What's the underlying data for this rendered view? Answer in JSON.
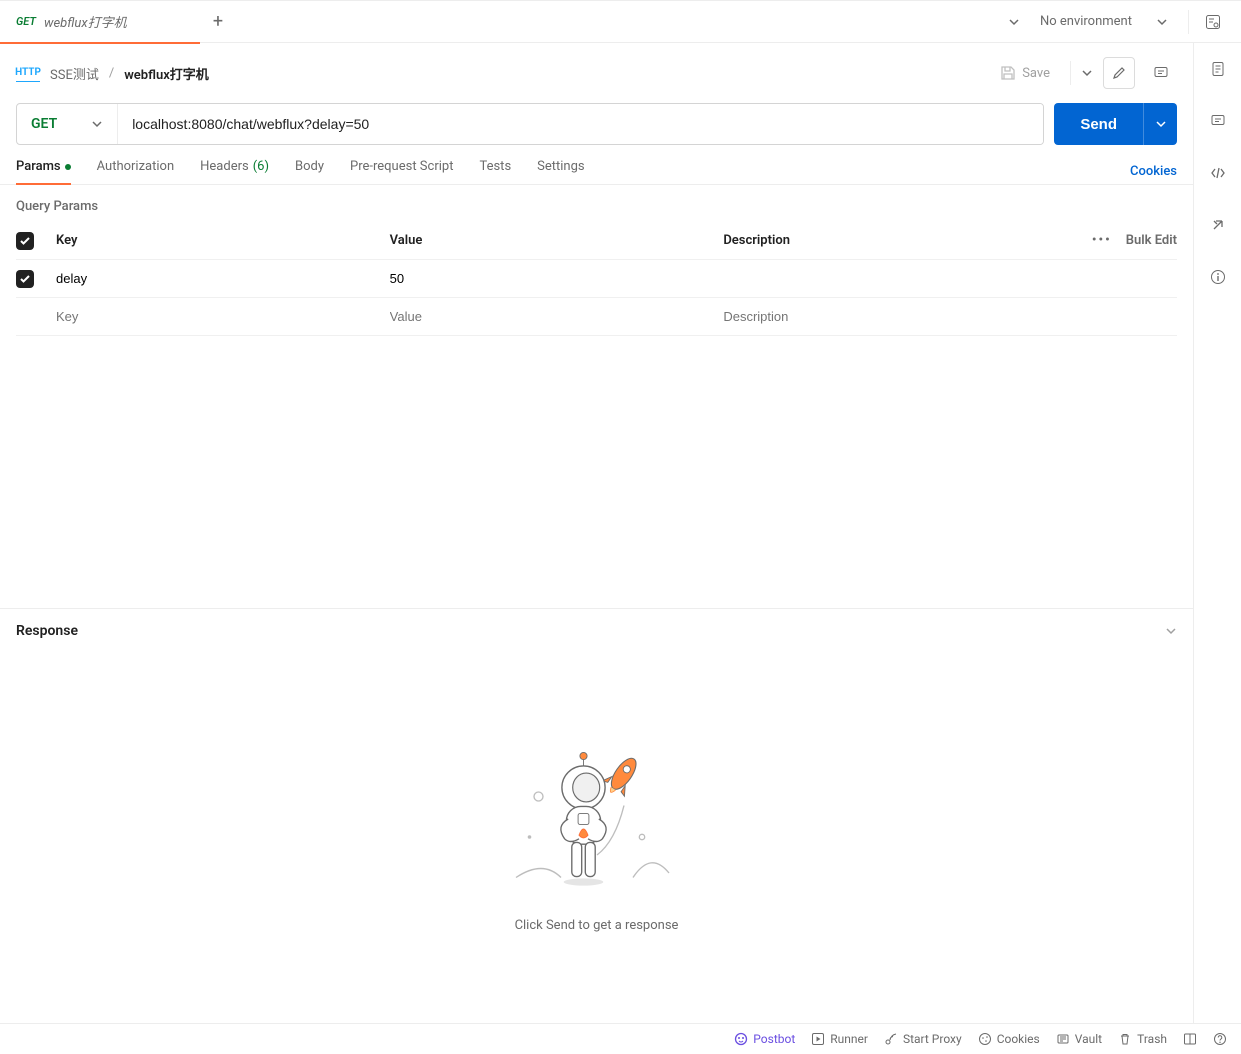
{
  "tab": {
    "method": "GET",
    "title": "webflux打字机",
    "method_color": "#0a7d33"
  },
  "environment": {
    "label": "No environment"
  },
  "breadcrumb": {
    "collection": "SSE测试",
    "request": "webflux打字机"
  },
  "actions": {
    "save_label": "Save"
  },
  "request": {
    "method": "GET",
    "url": "localhost:8080/chat/webflux?delay=50",
    "send_label": "Send"
  },
  "req_tabs": {
    "params": "Params",
    "authorization": "Authorization",
    "headers": "Headers",
    "headers_count": "(6)",
    "body": "Body",
    "prerequest": "Pre-request Script",
    "tests": "Tests",
    "settings": "Settings",
    "cookies": "Cookies"
  },
  "params_section": {
    "title": "Query Params",
    "columns": {
      "key": "Key",
      "value": "Value",
      "description": "Description"
    },
    "bulk_edit": "Bulk Edit",
    "rows": [
      {
        "checked": true,
        "key": "delay",
        "value": "50",
        "description": ""
      }
    ],
    "placeholders": {
      "key": "Key",
      "value": "Value",
      "description": "Description"
    }
  },
  "response": {
    "title": "Response",
    "empty_text": "Click Send to get a response"
  },
  "footer": {
    "postbot": "Postbot",
    "runner": "Runner",
    "start_proxy": "Start Proxy",
    "cookies": "Cookies",
    "vault": "Vault",
    "trash": "Trash"
  }
}
